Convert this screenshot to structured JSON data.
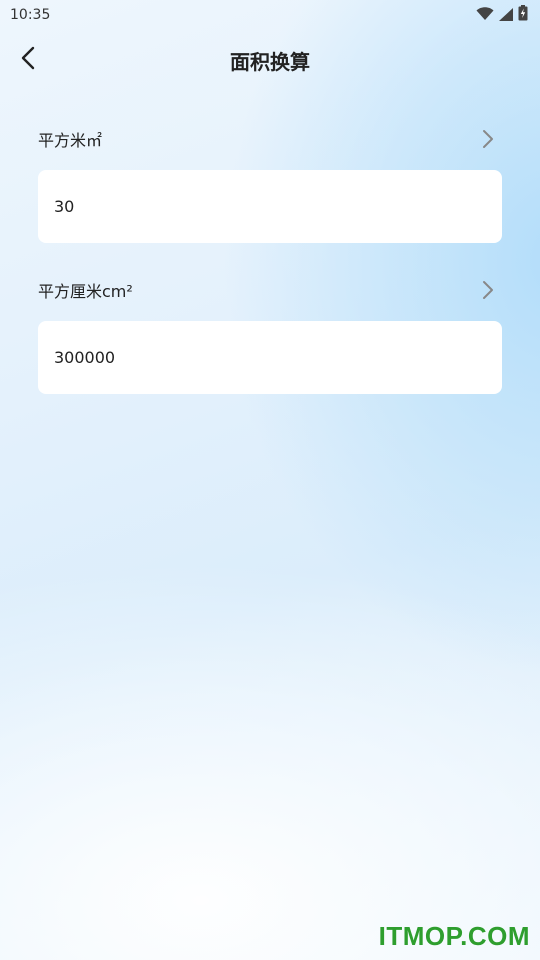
{
  "status_bar": {
    "time": "10:35",
    "icons": [
      "wifi-icon",
      "signal-icon",
      "battery-charging-icon"
    ]
  },
  "header": {
    "back_icon": "chevron-left-icon",
    "title": "面积换算"
  },
  "units": [
    {
      "label": "平方米㎡",
      "value": "30",
      "chevron_icon": "chevron-right-icon"
    },
    {
      "label": "平方厘米cm²",
      "value": "300000",
      "chevron_icon": "chevron-right-icon"
    }
  ],
  "watermark": "ITMOP.COM",
  "colors": {
    "text": "#222222",
    "chevron": "#888888",
    "card_bg": "#ffffff",
    "watermark": "#2e9e2e"
  }
}
